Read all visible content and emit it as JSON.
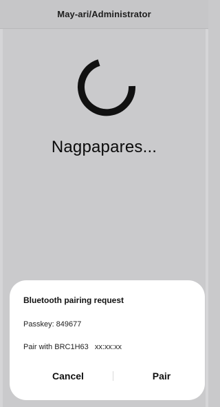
{
  "header": {
    "title": "May-ari/Administrator"
  },
  "status": {
    "message": "Nagpapares..."
  },
  "dialog": {
    "title": "Bluetooth pairing request",
    "passkey_label": "Passkey: 849677",
    "pair_with_label": "Pair with BRC1H63",
    "device_address": "xx:xx:xx",
    "cancel_label": "Cancel",
    "pair_label": "Pair"
  },
  "colors": {
    "background": "#cacacc",
    "dialog_background": "#ffffff",
    "text": "#111111",
    "spinner": "#111111"
  },
  "icons": {
    "spinner": "progress-spinner-icon"
  }
}
